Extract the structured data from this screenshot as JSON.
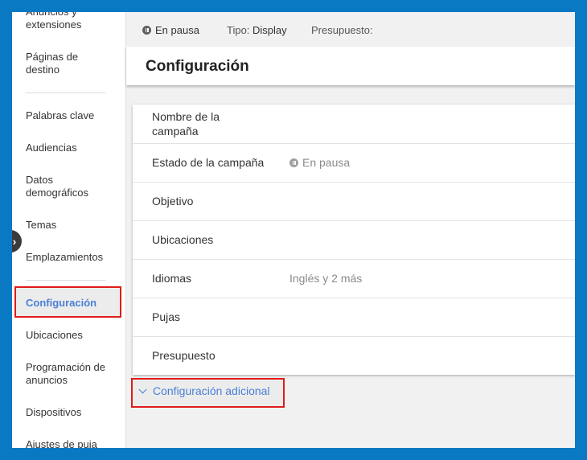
{
  "sidebar": {
    "items": [
      {
        "label": "Anuncios y extensiones"
      },
      {
        "label": "Páginas de destino"
      },
      {
        "label": "Palabras clave"
      },
      {
        "label": "Audiencias"
      },
      {
        "label": "Datos demográficos"
      },
      {
        "label": "Temas"
      },
      {
        "label": "Emplazamientos"
      },
      {
        "label": "Configuración",
        "active": true
      },
      {
        "label": "Ubicaciones"
      },
      {
        "label": "Programación de anuncios"
      },
      {
        "label": "Dispositivos"
      },
      {
        "label": "Ajustes de puja"
      }
    ],
    "toggle_glyph": "›"
  },
  "status_bar": {
    "status": "En pausa",
    "type_label": "Tipo:",
    "type_value": "Display",
    "budget_label": "Presupuesto:"
  },
  "header": {
    "title": "Configuración"
  },
  "settings": {
    "rows": [
      {
        "label": "Nombre de la campaña",
        "value": ""
      },
      {
        "label": "Estado de la campaña",
        "value": "En pausa"
      },
      {
        "label": "Objetivo",
        "value": ""
      },
      {
        "label": "Ubicaciones",
        "value": ""
      },
      {
        "label": "Idiomas",
        "value": "Inglés y 2 más"
      },
      {
        "label": "Pujas",
        "value": ""
      },
      {
        "label": "Presupuesto",
        "value": ""
      }
    ]
  },
  "additional": {
    "label": "Configuración adicional"
  },
  "colors": {
    "accent": "#4a7fd6",
    "highlight_border": "#e01b1b",
    "frame_border": "#0a79c4"
  }
}
